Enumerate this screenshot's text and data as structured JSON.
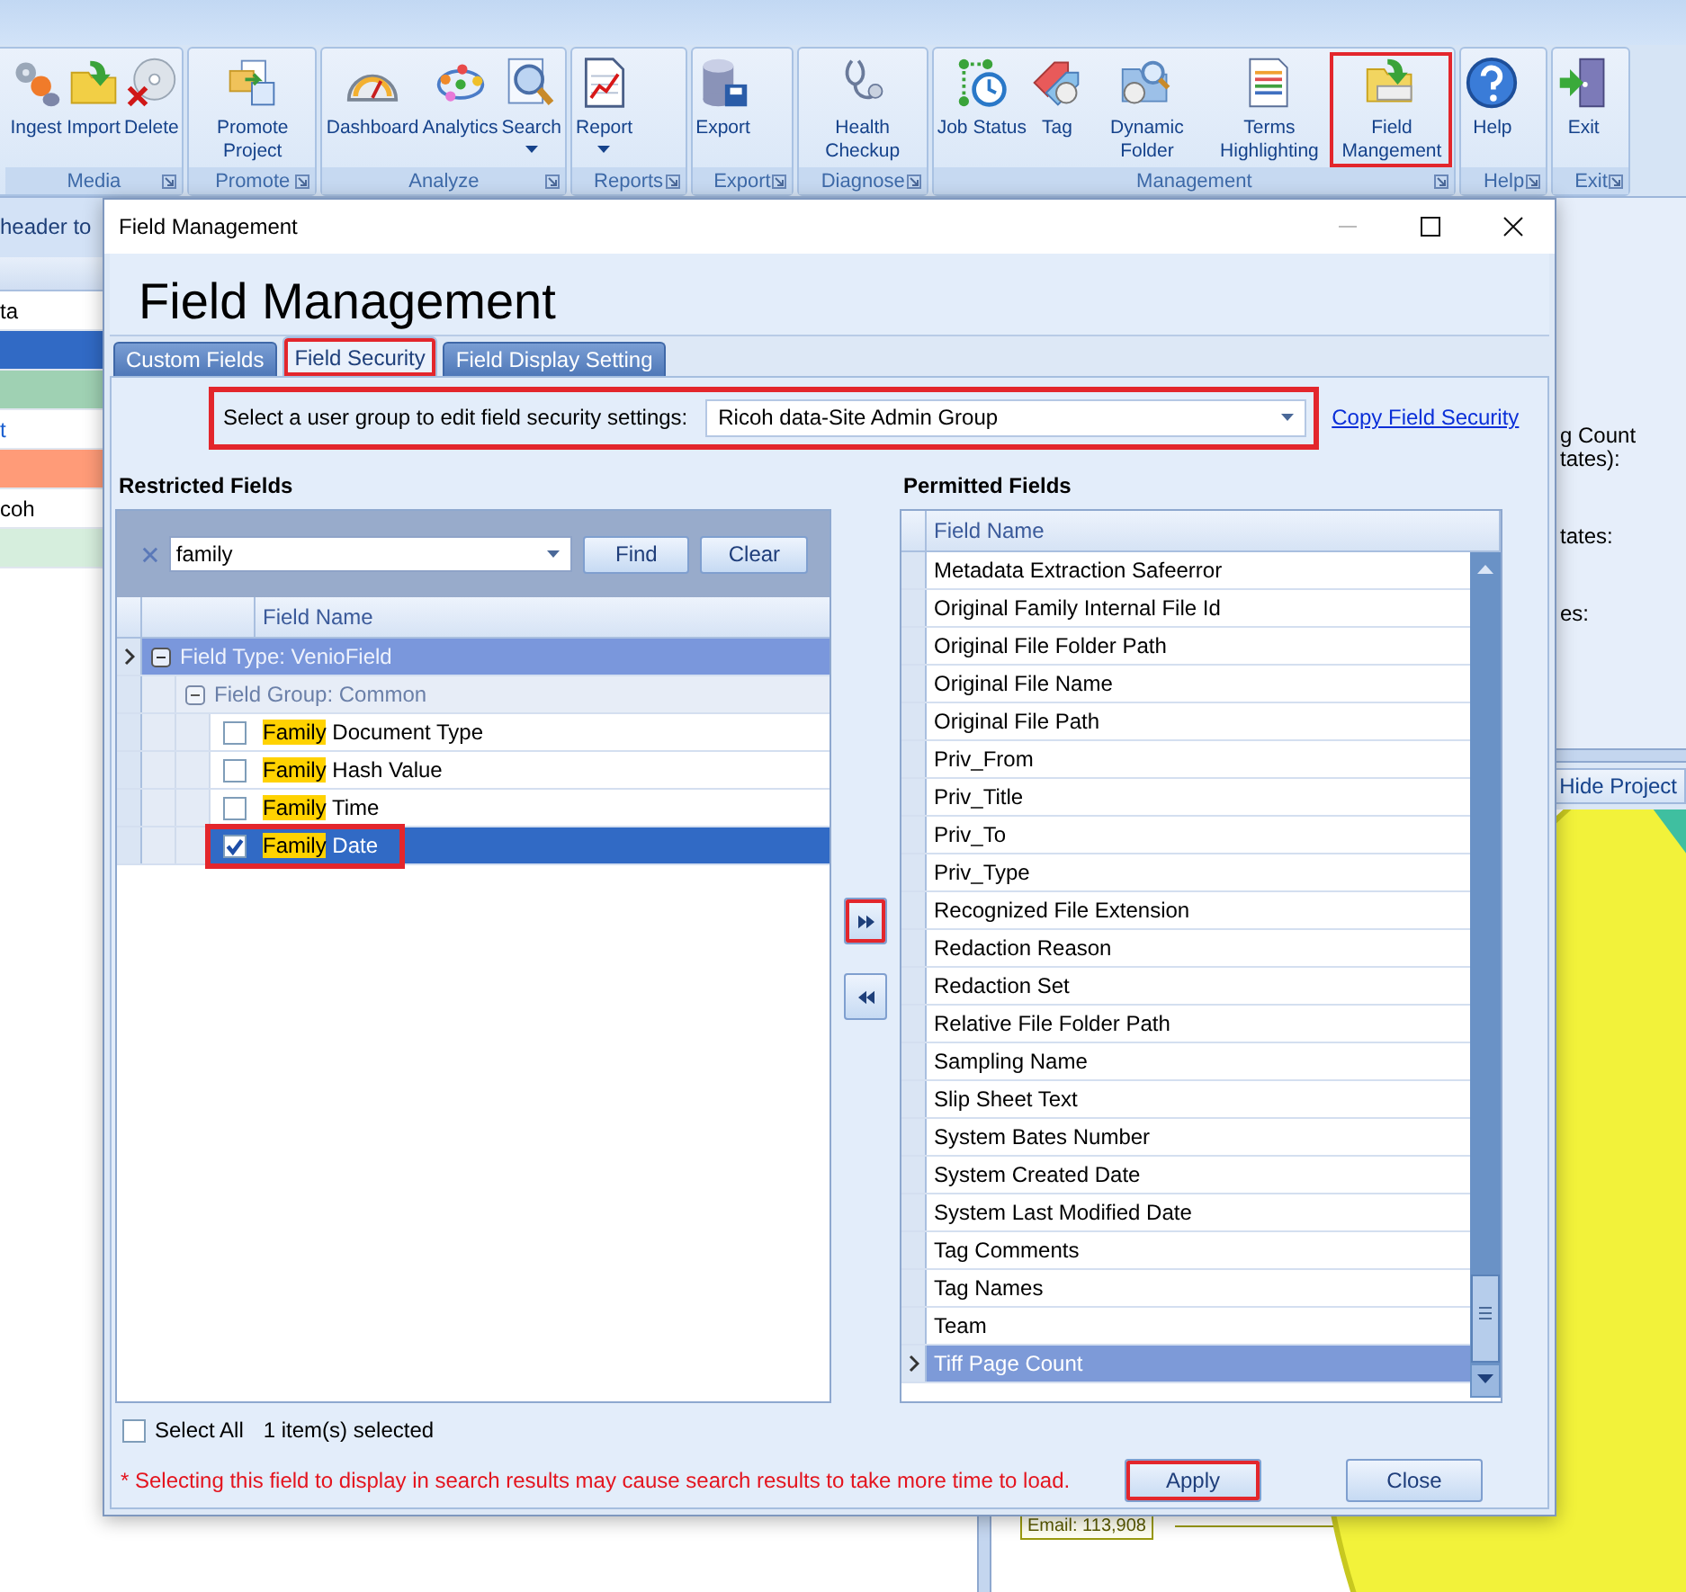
{
  "ribbon": {
    "groups": [
      {
        "label": "Media",
        "buttons": [
          {
            "label": "Ingest",
            "dropdown": false,
            "highlighted": false
          },
          {
            "label": "Import",
            "dropdown": false,
            "highlighted": false
          },
          {
            "label": "Delete",
            "dropdown": false,
            "highlighted": false
          }
        ]
      },
      {
        "label": "Promote",
        "buttons": [
          {
            "label": "Promote Project",
            "dropdown": false,
            "highlighted": false
          }
        ]
      },
      {
        "label": "Analyze",
        "buttons": [
          {
            "label": "Dashboard",
            "dropdown": false,
            "highlighted": false
          },
          {
            "label": "Analytics",
            "dropdown": false,
            "highlighted": false
          },
          {
            "label": "Search",
            "dropdown": true,
            "highlighted": false
          }
        ]
      },
      {
        "label": "Reports",
        "buttons": [
          {
            "label": "Report",
            "dropdown": true,
            "highlighted": false
          }
        ]
      },
      {
        "label": "Export",
        "buttons": [
          {
            "label": "Export",
            "dropdown": false,
            "highlighted": false
          }
        ]
      },
      {
        "label": "Diagnose",
        "buttons": [
          {
            "label": "Health Checkup",
            "dropdown": false,
            "highlighted": false
          }
        ]
      },
      {
        "label": "Management",
        "buttons": [
          {
            "label": "Job Status",
            "dropdown": false,
            "highlighted": false
          },
          {
            "label": "Tag",
            "dropdown": false,
            "highlighted": false
          },
          {
            "label": "Dynamic Folder",
            "dropdown": false,
            "highlighted": false
          },
          {
            "label": "Terms Highlighting",
            "dropdown": false,
            "highlighted": false
          },
          {
            "label": "Field Mangement",
            "dropdown": false,
            "highlighted": true
          }
        ]
      },
      {
        "label": "Help",
        "buttons": [
          {
            "label": "Help",
            "dropdown": false,
            "highlighted": false
          }
        ]
      },
      {
        "label": "Exit",
        "buttons": [
          {
            "label": "Exit",
            "dropdown": false,
            "highlighted": false
          }
        ]
      }
    ]
  },
  "left_pane": {
    "drop_hint": "header to",
    "rows": [
      {
        "text": "ta",
        "link": false,
        "color": "#ffffff"
      },
      {
        "color": "#316ac5"
      },
      {
        "color": "#9fd1b3"
      },
      {
        "text": "t",
        "link": true,
        "color": "#ffffff"
      },
      {
        "color": "#ff9b78"
      },
      {
        "text": "coh",
        "link": false,
        "color": "#ffffff"
      },
      {
        "color": "#d6eedd"
      }
    ]
  },
  "right_pane": {
    "labels": [
      {
        "lines": [
          "g Count",
          "tates):"
        ]
      },
      {
        "lines": [
          "tates:"
        ]
      },
      {
        "lines": [
          "es:"
        ]
      }
    ],
    "hide_button": "Hide Project",
    "chart_label": "Email: 113,908"
  },
  "dialog": {
    "title": "Field Management",
    "heading": "Field Management",
    "tabs": [
      {
        "label": "Custom Fields",
        "selected": false,
        "highlighted": false
      },
      {
        "label": "Field Security",
        "selected": true,
        "highlighted": true
      },
      {
        "label": "Field Display Setting",
        "selected": false,
        "highlighted": false
      }
    ],
    "user_group": {
      "label": "Select a user group to edit field security settings:",
      "value": "Ricoh data-Site Admin Group",
      "highlighted": true
    },
    "copy_link": "Copy Field Security",
    "restricted": {
      "heading": "Restricted Fields",
      "search": {
        "value": "family"
      },
      "find_button": "Find",
      "clear_button": "Clear",
      "column": "Field Name",
      "group": {
        "label": "Field Type: VenioField",
        "expanded": true,
        "focused": true,
        "subgroup": {
          "label": "Field Group: Common",
          "expanded": true,
          "rows": [
            {
              "match": "Family",
              "rest": " Document Type",
              "checked": false,
              "selected": false,
              "highlighted": false
            },
            {
              "match": "Family",
              "rest": " Hash Value",
              "checked": false,
              "selected": false,
              "highlighted": false
            },
            {
              "match": "Family",
              "rest": " Time",
              "checked": false,
              "selected": false,
              "highlighted": false
            },
            {
              "match": "Family",
              "rest": " Date",
              "checked": true,
              "selected": true,
              "highlighted": true
            }
          ]
        }
      }
    },
    "select_all": {
      "label": "Select All",
      "checked": false
    },
    "selection_count": "1 item(s) selected",
    "move_buttons": [
      {
        "kind": "add",
        "highlighted": true
      },
      {
        "kind": "remove",
        "highlighted": false
      }
    ],
    "permitted": {
      "heading": "Permitted Fields",
      "column": "Field Name",
      "rows": [
        {
          "name": "Metadata Extraction Safeerror",
          "selected": false
        },
        {
          "name": "Original Family Internal File Id",
          "selected": false
        },
        {
          "name": "Original File Folder Path",
          "selected": false
        },
        {
          "name": "Original File Name",
          "selected": false
        },
        {
          "name": "Original File Path",
          "selected": false
        },
        {
          "name": "Priv_From",
          "selected": false
        },
        {
          "name": "Priv_Title",
          "selected": false
        },
        {
          "name": "Priv_To",
          "selected": false
        },
        {
          "name": "Priv_Type",
          "selected": false
        },
        {
          "name": "Recognized File Extension",
          "selected": false
        },
        {
          "name": "Redaction Reason",
          "selected": false
        },
        {
          "name": "Redaction Set",
          "selected": false
        },
        {
          "name": "Relative File Folder Path",
          "selected": false
        },
        {
          "name": "Sampling Name",
          "selected": false
        },
        {
          "name": "Slip Sheet Text",
          "selected": false
        },
        {
          "name": "System Bates Number",
          "selected": false
        },
        {
          "name": "System Created Date",
          "selected": false
        },
        {
          "name": "System Last Modified Date",
          "selected": false
        },
        {
          "name": "Tag Comments",
          "selected": false
        },
        {
          "name": "Tag Names",
          "selected": false
        },
        {
          "name": "Team",
          "selected": false
        },
        {
          "name": "Tiff Page Count",
          "selected": true
        }
      ]
    },
    "note": "* Selecting this field to display in search results may cause search results to take more time to load.",
    "buttons": [
      {
        "label": "Apply",
        "highlighted": true
      },
      {
        "label": "Close",
        "highlighted": false
      }
    ]
  }
}
